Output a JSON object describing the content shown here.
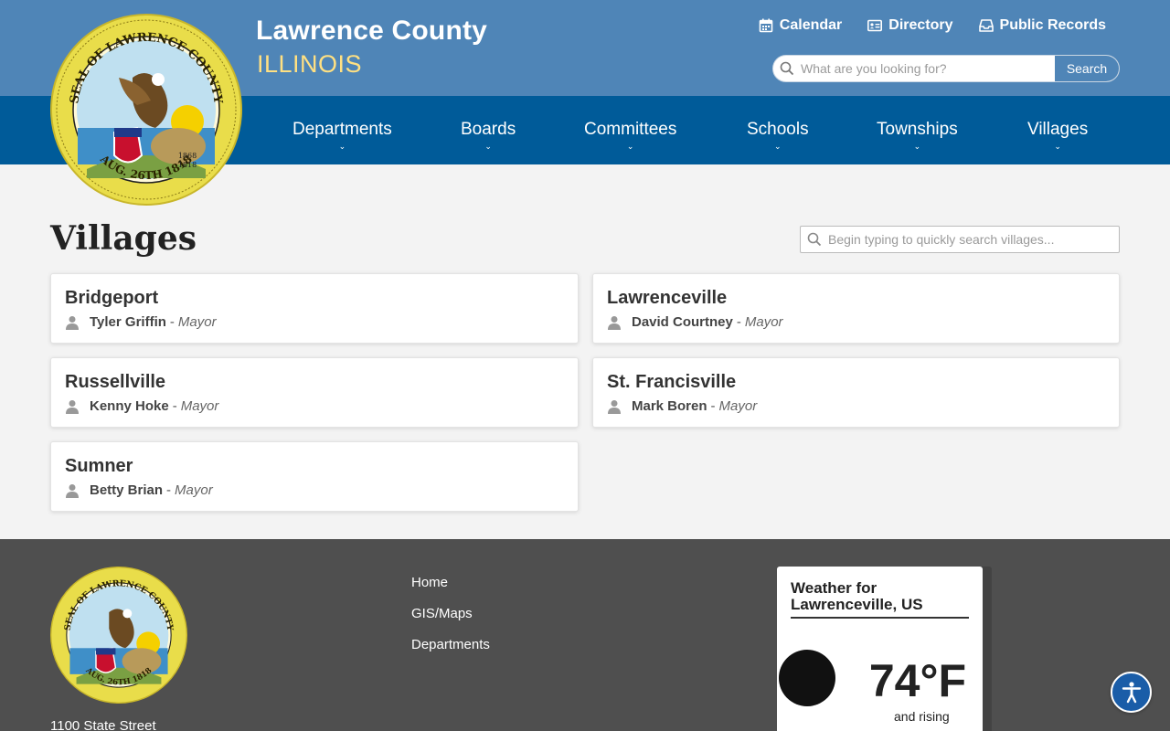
{
  "header": {
    "title": "Lawrence County",
    "subtitle": "ILLINOIS",
    "seal_text": "SEAL OF LAWRENCE COUNTY",
    "seal_date": "AUG. 26TH 1818",
    "seal_years": [
      "1868",
      "1818"
    ],
    "util_links": [
      {
        "label": "Calendar",
        "icon": "calendar-icon"
      },
      {
        "label": "Directory",
        "icon": "id-card-icon"
      },
      {
        "label": "Public Records",
        "icon": "inbox-icon"
      }
    ],
    "search": {
      "placeholder": "What are you looking for?",
      "button": "Search"
    }
  },
  "nav": {
    "items": [
      {
        "label": "Departments"
      },
      {
        "label": "Boards"
      },
      {
        "label": "Committees"
      },
      {
        "label": "Schools"
      },
      {
        "label": "Townships"
      },
      {
        "label": "Villages"
      }
    ]
  },
  "main": {
    "title": "Villages",
    "filter_placeholder": "Begin typing to quickly search villages...",
    "villages": [
      {
        "name": "Bridgeport",
        "person": "Tyler Griffin",
        "sep": "-",
        "role": "Mayor"
      },
      {
        "name": "Lawrenceville",
        "person": "David Courtney",
        "sep": "-",
        "role": "Mayor"
      },
      {
        "name": "Russellville",
        "person": "Kenny Hoke",
        "sep": "-",
        "role": "Mayor"
      },
      {
        "name": "St. Francisville",
        "person": "Mark Boren",
        "sep": "-",
        "role": "Mayor"
      },
      {
        "name": "Sumner",
        "person": "Betty Brian",
        "sep": "-",
        "role": "Mayor"
      }
    ]
  },
  "footer": {
    "address": "1100 State Street",
    "links": [
      "Home",
      "GIS/Maps",
      "Departments"
    ],
    "weather": {
      "title": "Weather for Lawrenceville, US",
      "temp": "74°F",
      "trend": "and rising"
    }
  },
  "colors": {
    "topbar": "#4f85b7",
    "navbar": "#005b99",
    "subtitle": "#ffe082",
    "footer": "#4f4f4f"
  }
}
